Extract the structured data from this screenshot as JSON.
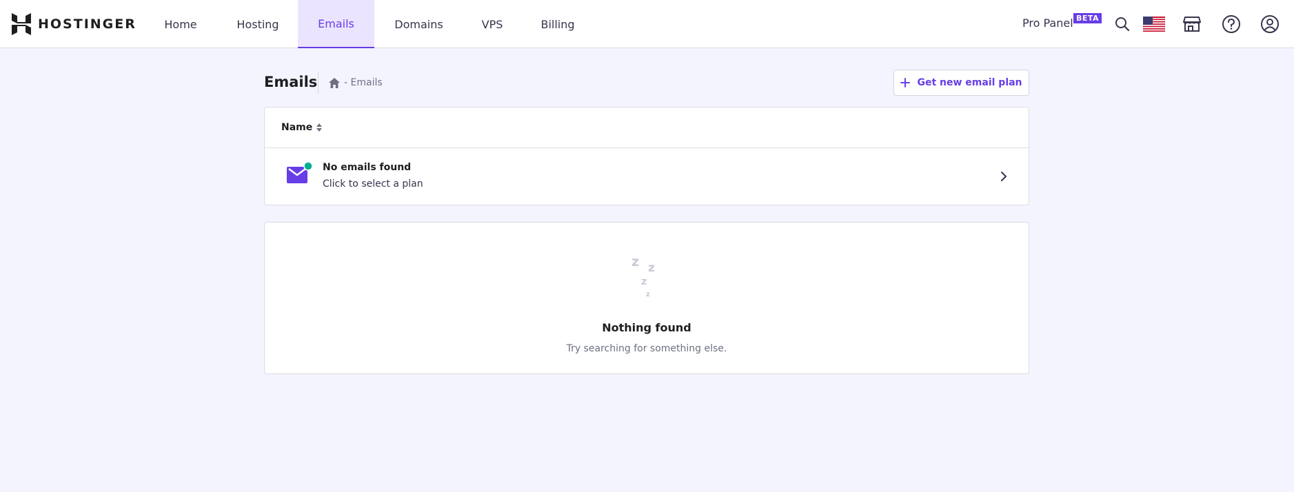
{
  "header": {
    "logo_text": "HOSTINGER",
    "nav": [
      {
        "label": "Home"
      },
      {
        "label": "Hosting"
      },
      {
        "label": "Emails"
      },
      {
        "label": "Domains"
      },
      {
        "label": "VPS"
      },
      {
        "label": "Billing"
      }
    ],
    "active_nav": "Emails",
    "pro_panel_label": "Pro Panel",
    "pro_panel_badge": "BETA",
    "icons": [
      "search-icon",
      "us-flag-icon",
      "store-icon",
      "help-icon",
      "account-icon"
    ]
  },
  "page": {
    "title": "Emails",
    "breadcrumb_current": "- Emails",
    "get_plan_label": "Get new email plan"
  },
  "table": {
    "column_name": "Name",
    "row": {
      "title": "No emails found",
      "subtitle": "Click to select a plan"
    }
  },
  "empty_state": {
    "title": "Nothing found",
    "subtitle": "Try searching for something else."
  },
  "colors": {
    "accent": "#673de6",
    "accent_light": "#ebe4ff",
    "status_dot": "#00b090",
    "page_bg": "#f4f4ff"
  }
}
